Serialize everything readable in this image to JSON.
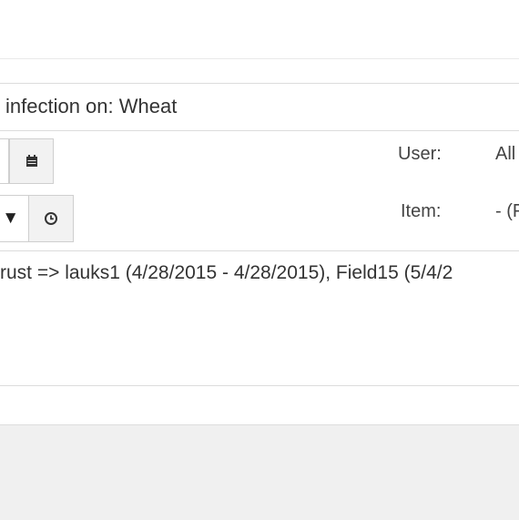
{
  "panel": {
    "title": "infection on: Wheat",
    "user_label": "User:",
    "user_value": "All",
    "item_label": "Item:",
    "item_value": "- (F",
    "time_select_value": "▼",
    "detail_text": "rust => lauks1 (4/28/2015 - 4/28/2015), Field15 (5/4/2"
  },
  "icons": {
    "calendar": "calendar-icon",
    "clock": "clock-icon",
    "dropdown": "caret-down-icon"
  },
  "colors": {
    "border": "#dcdcdc",
    "button_bg": "#f2f2f2",
    "footer_bg": "#f0f0f0"
  }
}
